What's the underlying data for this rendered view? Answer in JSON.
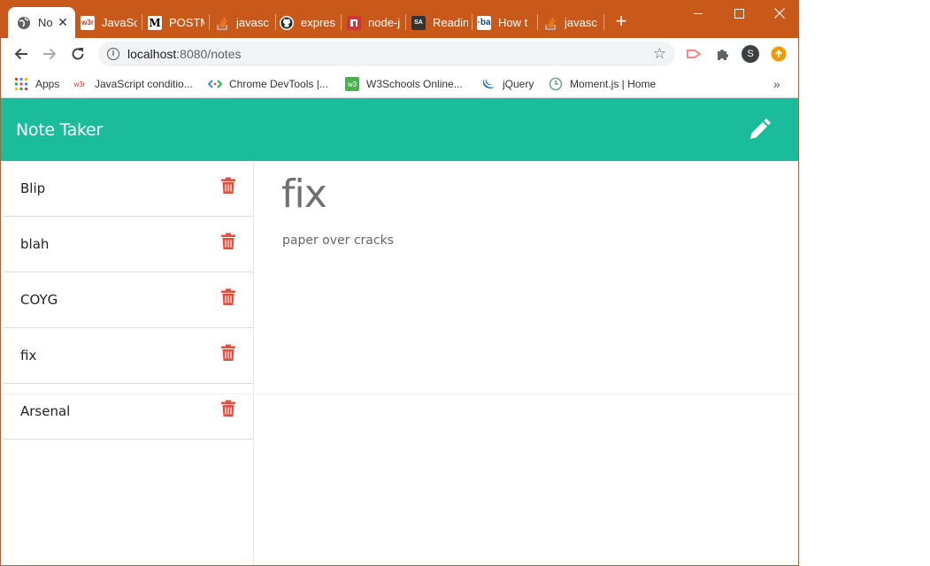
{
  "browser": {
    "tabs": [
      {
        "title": "Note Taker",
        "icon": "globe-icon",
        "active": true
      },
      {
        "title": "JavaScript",
        "icon": "w3r-icon"
      },
      {
        "title": "POSTMAN",
        "icon": "medium-icon"
      },
      {
        "title": "javascript",
        "icon": "stackoverflow-icon"
      },
      {
        "title": "express",
        "icon": "github-icon"
      },
      {
        "title": "node-js",
        "icon": "npm-icon"
      },
      {
        "title": "Reading",
        "icon": "sa-icon"
      },
      {
        "title": "How to",
        "icon": "ba-icon"
      },
      {
        "title": "javascript",
        "icon": "stackoverflow-icon"
      }
    ],
    "active_tab_title_shown": "No",
    "tab_titles_shown": [
      "JavaSc",
      "POSTM",
      "javasc",
      "expres",
      "node-j",
      "Readin",
      "How t",
      "javasc"
    ],
    "address": {
      "host": "localhost",
      "port_path": ":8080/notes"
    },
    "bookmarks": [
      {
        "label": "Apps",
        "icon": "apps-icon"
      },
      {
        "label": "JavaScript conditio...",
        "icon": "w3r-icon"
      },
      {
        "label": "Chrome DevTools |...",
        "icon": "devtools-icon"
      },
      {
        "label": "W3Schools Online...",
        "icon": "w3schools-icon"
      },
      {
        "label": "jQuery",
        "icon": "jquery-icon"
      },
      {
        "label": "Moment.js | Home",
        "icon": "clock-icon"
      }
    ],
    "profile_initial": "S",
    "accent": "#c9581b"
  },
  "app": {
    "brand": "Note Taker",
    "brand_color": "#1abc9c",
    "delete_color": "#e74c3c",
    "notes": [
      {
        "title": "Blip"
      },
      {
        "title": "blah"
      },
      {
        "title": "COYG"
      },
      {
        "title": "fix"
      },
      {
        "title": "Arsenal"
      }
    ],
    "active_note": {
      "title": "fix",
      "text": "paper over cracks"
    }
  }
}
